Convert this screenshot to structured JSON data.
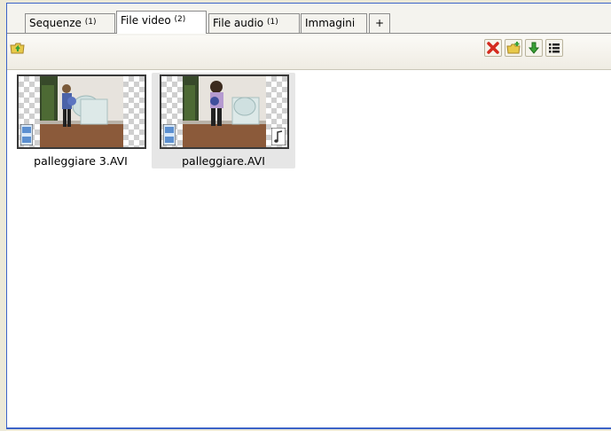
{
  "tabs": [
    {
      "label": "Sequenze",
      "count": "(1)"
    },
    {
      "label": "File video",
      "count": "(2)"
    },
    {
      "label": "File audio",
      "count": "(1)"
    },
    {
      "label": "Immagini",
      "count": ""
    },
    {
      "label": "+",
      "count": ""
    }
  ],
  "toolbar": {
    "left_icon": "folder-up-icon",
    "right_icons": [
      "delete-icon",
      "new-folder-icon",
      "import-down-icon",
      "list-view-icon"
    ]
  },
  "files": [
    {
      "name": "palleggiare 3.AVI",
      "type_icon": "film-icon",
      "has_audio": false,
      "selected": false
    },
    {
      "name": "palleggiare.AVI",
      "type_icon": "film-icon",
      "has_audio": true,
      "selected": true
    }
  ],
  "colors": {
    "frame_border": "#3c63c8",
    "selection": "#e6e6e6",
    "delete_red": "#d42a1e",
    "arrow_green": "#3aa236"
  }
}
